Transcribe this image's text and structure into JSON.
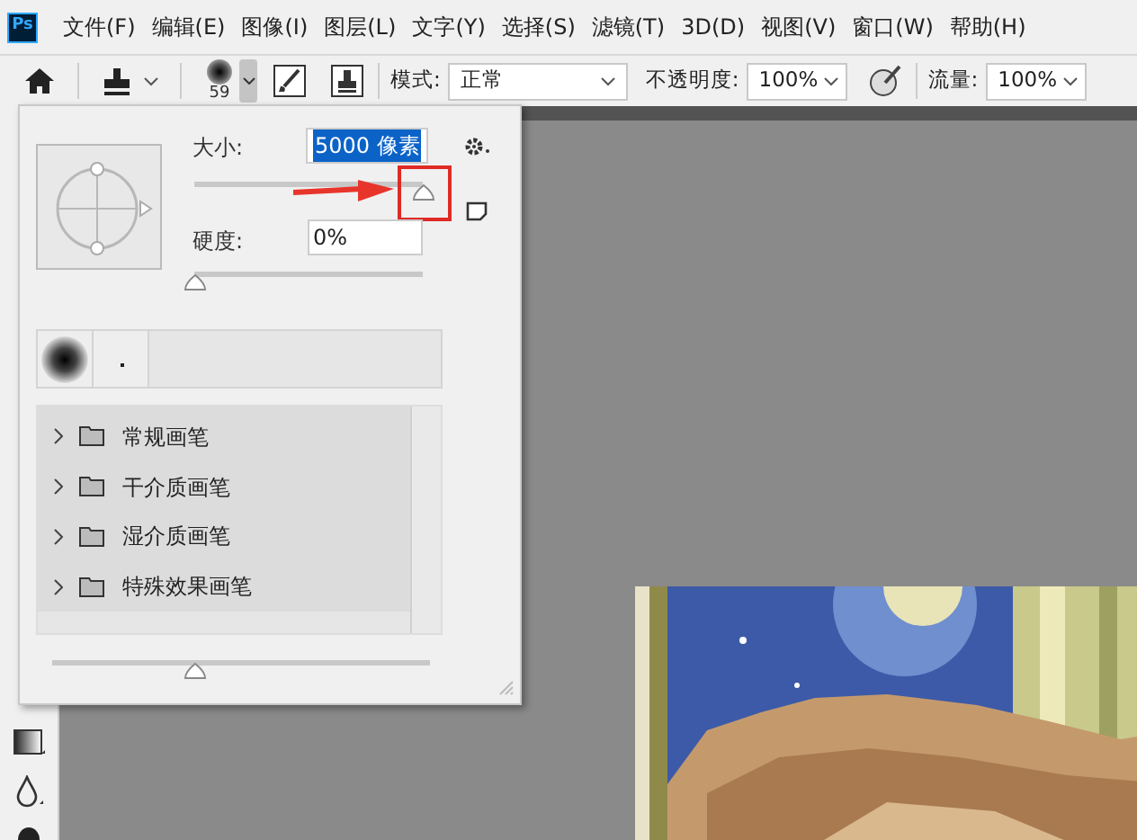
{
  "app": {
    "logo": "Ps"
  },
  "menu": [
    "文件(F)",
    "编辑(E)",
    "图像(I)",
    "图层(L)",
    "文字(Y)",
    "选择(S)",
    "滤镜(T)",
    "3D(D)",
    "视图(V)",
    "窗口(W)",
    "帮助(H)"
  ],
  "options_bar": {
    "brush_size": "59",
    "mode_label": "模式:",
    "mode_value": "正常",
    "opacity_label": "不透明度:",
    "opacity_value": "100%",
    "flow_label": "流量:",
    "flow_value": "100%"
  },
  "brush_panel": {
    "size_label": "大小:",
    "size_value": {
      "text": "5000 像素",
      "selected": true
    },
    "size_slider": {
      "level": 1.0
    },
    "hardness_label": "硬度:",
    "hardness_value": "0%",
    "hardness_slider": {
      "level": 0
    },
    "folders": [
      {
        "label": "常规画笔",
        "expanded": false
      },
      {
        "label": "干介质画笔",
        "expanded": false
      },
      {
        "label": "湿介质画笔",
        "expanded": false
      },
      {
        "label": "特殊效果画笔",
        "expanded": false
      }
    ],
    "preview_slider": {
      "level": 0.38
    }
  }
}
